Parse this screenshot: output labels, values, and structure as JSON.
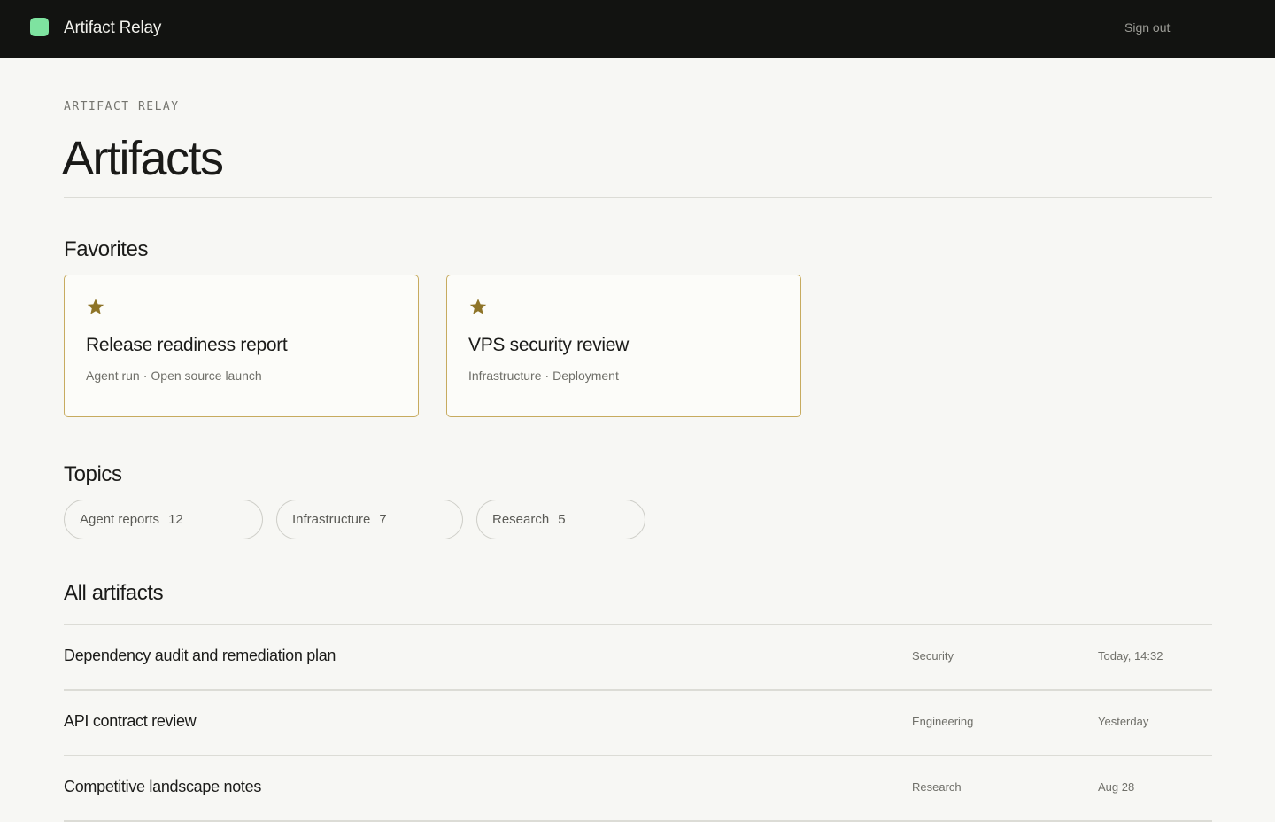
{
  "header": {
    "app_name": "Artifact Relay",
    "sign_out_label": "Sign out",
    "logo_color": "#7ee3a0"
  },
  "page": {
    "eyebrow": "ARTIFACT RELAY",
    "title": "Artifacts"
  },
  "favorites": {
    "title": "Favorites",
    "icon": "star-icon",
    "accent_color": "#8e7428",
    "items": [
      {
        "title": "Release readiness report",
        "meta": [
          "Agent run",
          "Open source launch"
        ]
      },
      {
        "title": "VPS security review",
        "meta": [
          "Infrastructure",
          "Deployment"
        ]
      }
    ]
  },
  "topics": {
    "title": "Topics",
    "items": [
      {
        "label": "Agent reports",
        "count": "12"
      },
      {
        "label": "Infrastructure",
        "count": "7"
      },
      {
        "label": "Research",
        "count": "5"
      }
    ]
  },
  "all_artifacts": {
    "title": "All artifacts",
    "rows": [
      {
        "title": "Dependency audit and remediation plan",
        "category": "Security",
        "date": "Today, 14:32"
      },
      {
        "title": "API contract review",
        "category": "Engineering",
        "date": "Yesterday"
      },
      {
        "title": "Competitive landscape notes",
        "category": "Research",
        "date": "Aug 28"
      }
    ]
  }
}
